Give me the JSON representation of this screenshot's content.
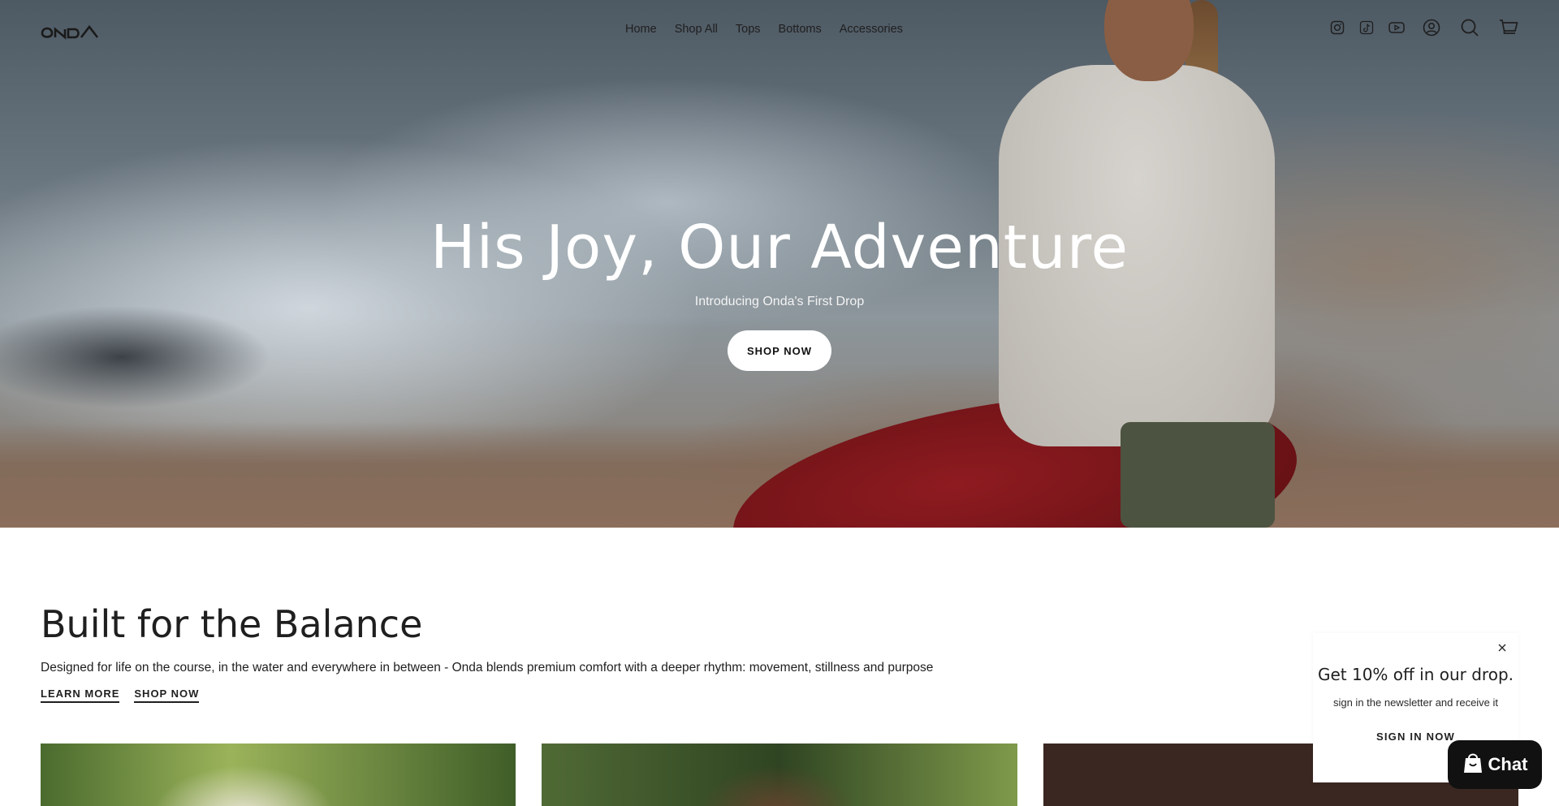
{
  "header": {
    "logo_text": "ONDA",
    "nav": [
      "Home",
      "Shop All",
      "Tops",
      "Bottoms",
      "Accessories"
    ],
    "icons": [
      "instagram-icon",
      "tiktok-icon",
      "youtube-icon",
      "account-icon",
      "search-icon",
      "cart-icon"
    ]
  },
  "hero": {
    "title": "His Joy, Our Adventure",
    "subtitle": "Introducing Onda's First Drop",
    "cta": "SHOP NOW"
  },
  "section": {
    "title": "Built for the Balance",
    "description": "Designed for life on the course, in the water and everywhere in between - Onda blends premium comfort with a deeper rhythm: movement, stillness and purpose",
    "links": [
      "LEARN MORE",
      "SHOP NOW"
    ]
  },
  "popup": {
    "title": "Get 10% off in our drop.",
    "subtitle": "sign in the newsletter and receive it",
    "cta": "SIGN IN NOW"
  },
  "chat": {
    "label": "Chat"
  },
  "colors": {
    "text": "#1f1f1f",
    "hero_text": "#ffffff",
    "chat_bg": "#111111"
  }
}
